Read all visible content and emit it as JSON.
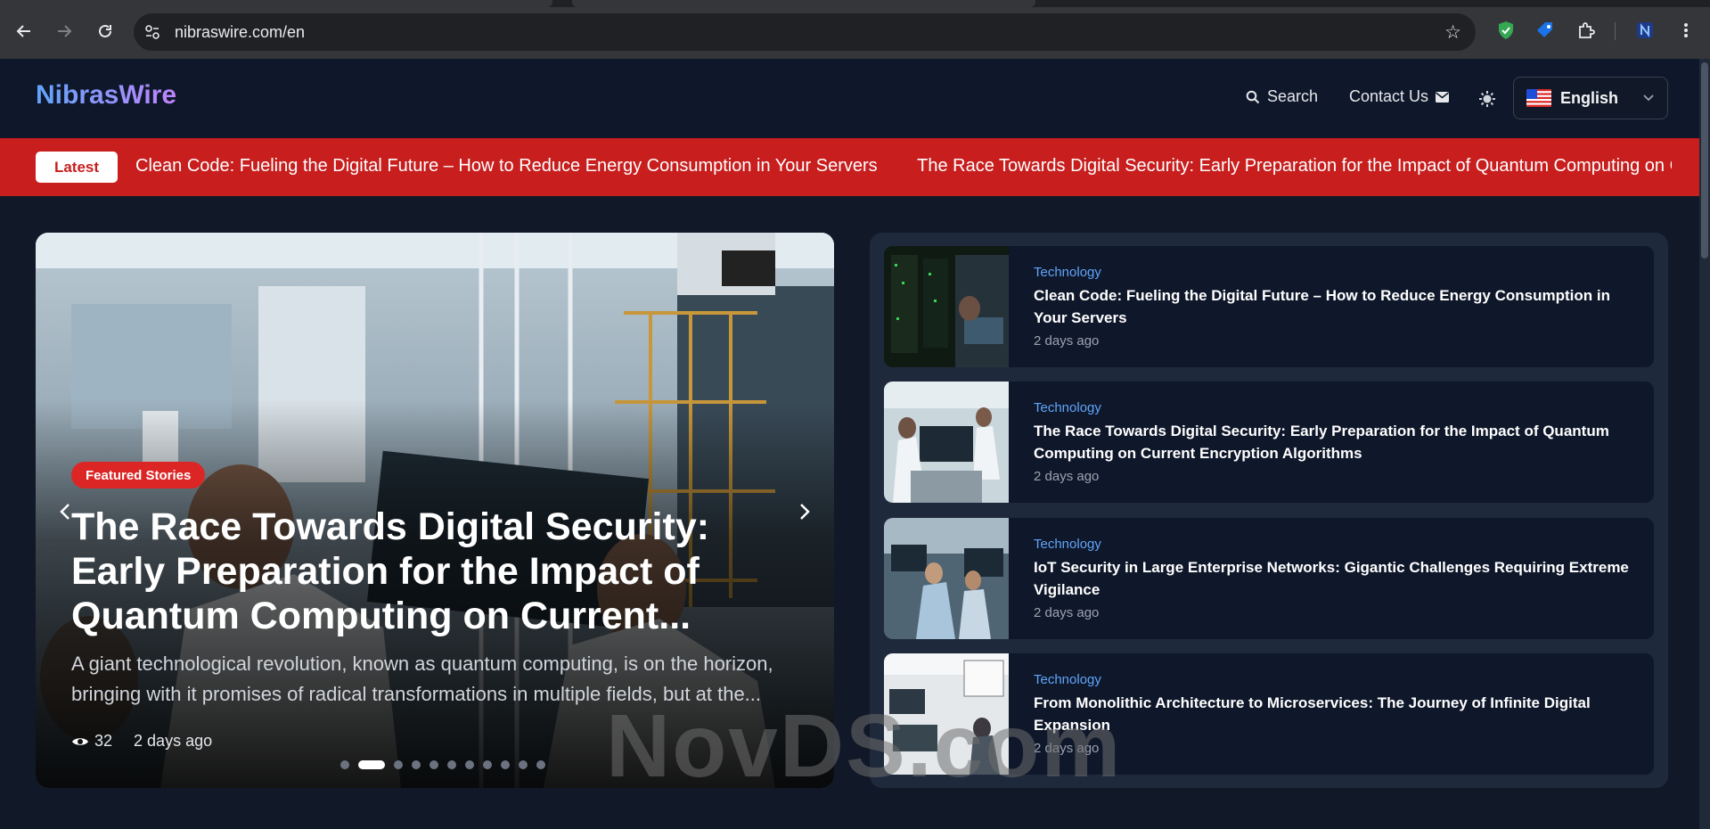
{
  "browser": {
    "url": "nibraswire.com/en"
  },
  "header": {
    "logo": "NibrasWire",
    "search_label": "Search",
    "contact_label": "Contact Us",
    "language_label": "English"
  },
  "ticker": {
    "badge": "Latest",
    "items": [
      "Clean Code: Fueling the Digital Future – How to Reduce Energy Consumption in Your Servers",
      "The Race Towards Digital Security: Early Preparation for the Impact of Quantum Computing on Cur"
    ]
  },
  "hero": {
    "badge": "Featured Stories",
    "title": "The Race Towards Digital Security: Early Preparation for the Impact of Quantum Computing on Current...",
    "excerpt": "A giant technological revolution, known as quantum computing, is on the horizon, bringing with it promises of radical transformations in multiple fields, but at the...",
    "views": "32",
    "time": "2 days ago",
    "slide_count": 11,
    "active_slide": 2
  },
  "side_list": [
    {
      "category": "Technology",
      "title": "Clean Code: Fueling the Digital Future – How to Reduce Energy Consumption in Your Servers",
      "time": "2 days ago"
    },
    {
      "category": "Technology",
      "title": "The Race Towards Digital Security: Early Preparation for the Impact of Quantum Computing on Current Encryption Algorithms",
      "time": "2 days ago"
    },
    {
      "category": "Technology",
      "title": "IoT Security in Large Enterprise Networks: Gigantic Challenges Requiring Extreme Vigilance",
      "time": "2 days ago"
    },
    {
      "category": "Technology",
      "title": "From Monolithic Architecture to Microservices: The Journey of Infinite Digital Expansion",
      "time": "2 days ago"
    }
  ],
  "watermark": "NovDS.com",
  "colors": {
    "ticker_bg": "#c81e1e",
    "category": "#60a5fa",
    "badge": "#dc2626",
    "page_bg": "#111827"
  }
}
